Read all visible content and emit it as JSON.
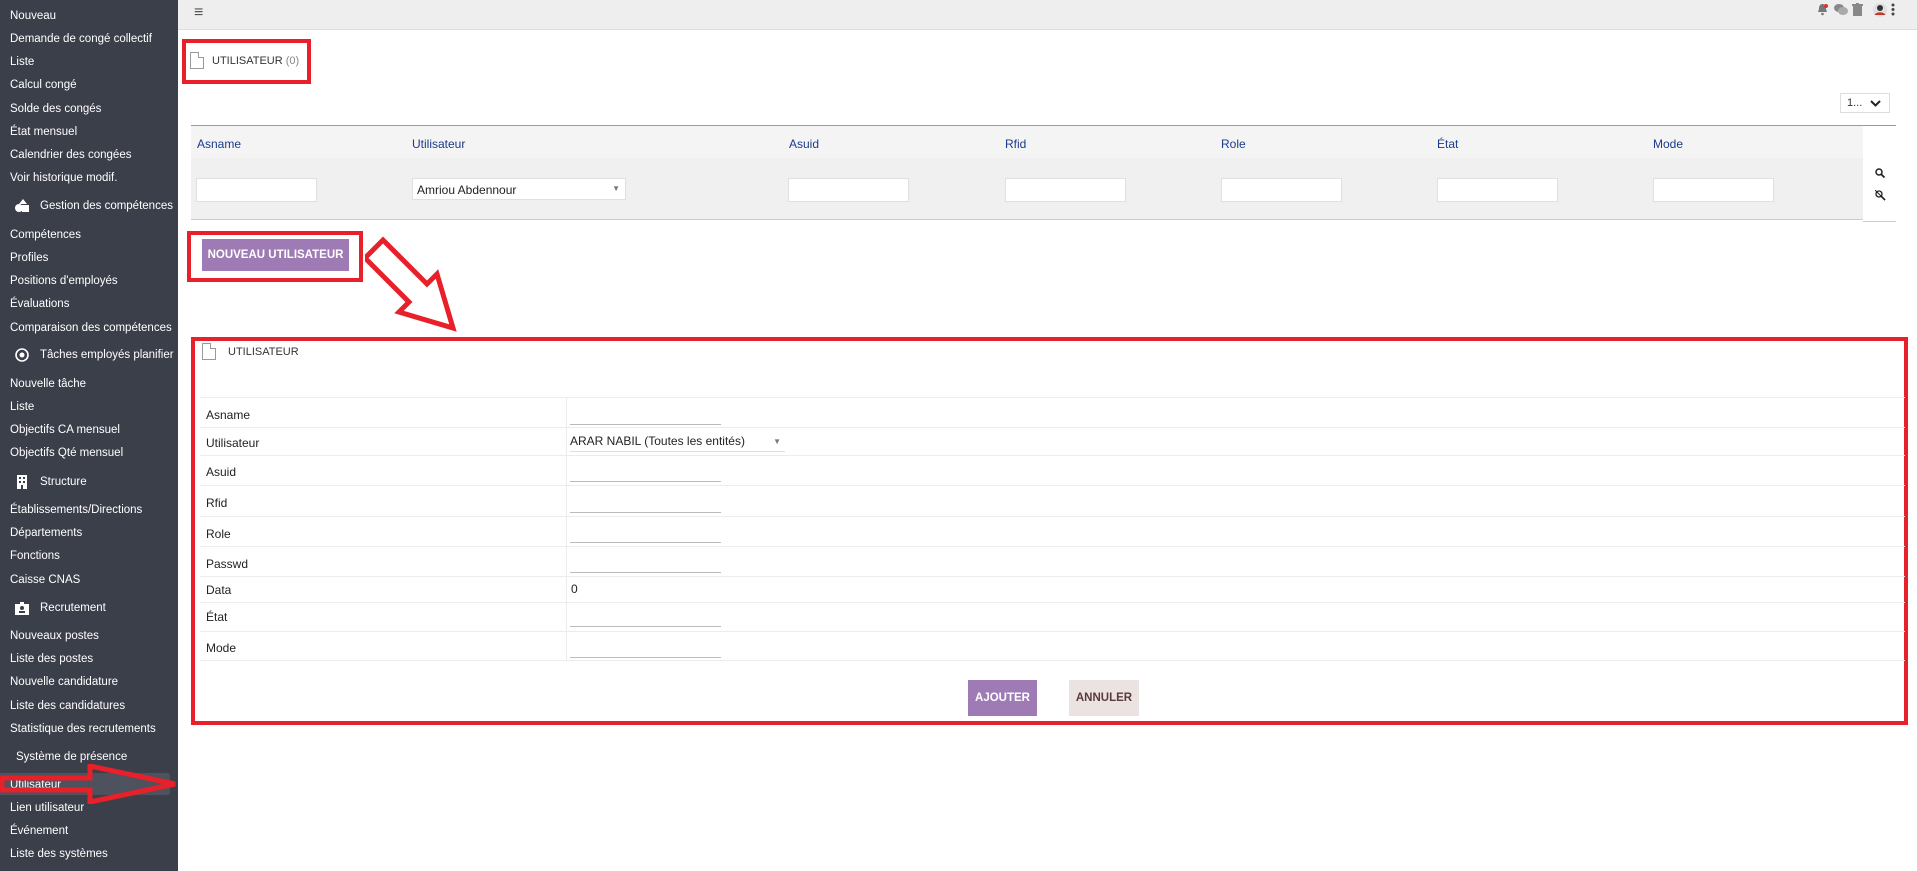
{
  "sidebar": {
    "items": [
      {
        "label": "Nouveau"
      },
      {
        "label": "Demande de congé collectif"
      },
      {
        "label": "Liste"
      },
      {
        "label": "Calcul congé"
      },
      {
        "label": "Solde des congés"
      },
      {
        "label": "État mensuel"
      },
      {
        "label": "Calendrier des congées"
      },
      {
        "label": "Voir historique modif."
      },
      {
        "label": "Gestion des compétences",
        "icon": "shapes-icon"
      },
      {
        "label": "Compétences"
      },
      {
        "label": "Profiles"
      },
      {
        "label": "Positions d'employés"
      },
      {
        "label": "Évaluations"
      },
      {
        "label": "Comparaison des compétences"
      },
      {
        "label": "Tâches employés planifier",
        "icon": "target-icon"
      },
      {
        "label": "Nouvelle tâche"
      },
      {
        "label": "Liste"
      },
      {
        "label": "Objectifs CA mensuel"
      },
      {
        "label": "Objectifs Qté mensuel"
      },
      {
        "label": "Structure",
        "icon": "building-icon"
      },
      {
        "label": "Établissements/Directions"
      },
      {
        "label": "Départements"
      },
      {
        "label": "Fonctions"
      },
      {
        "label": "Caisse CNAS"
      },
      {
        "label": "Recrutement",
        "icon": "id-badge-icon"
      },
      {
        "label": "Nouveaux postes"
      },
      {
        "label": "Liste des postes"
      },
      {
        "label": "Nouvelle candidature"
      },
      {
        "label": "Liste des candidatures"
      },
      {
        "label": "Statistique des recrutements"
      },
      {
        "label": "Système de présence"
      },
      {
        "label": "Utilisateur"
      },
      {
        "label": "Lien utilisateur"
      },
      {
        "label": "Événement"
      },
      {
        "label": "Liste des systèmes"
      }
    ]
  },
  "topbar": {
    "menu_icon": "≡",
    "icons": [
      "bell-icon",
      "chat-icon",
      "trash-icon",
      "user-avatar-icon",
      "more-vert-icon"
    ]
  },
  "list": {
    "title": "UTILISATEUR",
    "count": "(0)",
    "pager_value": "1...",
    "columns": [
      "Asname",
      "Utilisateur",
      "Asuid",
      "Rfid",
      "Role",
      "État",
      "Mode"
    ],
    "filter_user_value": "Amriou Abdennour",
    "new_button_label": "NOUVEAU UTILISATEUR"
  },
  "form": {
    "title": "UTILISATEUR",
    "fields": [
      {
        "label": "Asname",
        "value": ""
      },
      {
        "label": "Utilisateur",
        "value": "ARAR NABIL (Toutes les entités)"
      },
      {
        "label": "Asuid",
        "value": ""
      },
      {
        "label": "Rfid",
        "value": ""
      },
      {
        "label": "Role",
        "value": ""
      },
      {
        "label": "Passwd",
        "value": ""
      },
      {
        "label": "Data",
        "value": "0"
      },
      {
        "label": "État",
        "value": ""
      },
      {
        "label": "Mode",
        "value": ""
      }
    ],
    "add_label": "AJOUTER",
    "cancel_label": "ANNULER"
  },
  "colors": {
    "sidebar_bg": "#3b3f4a",
    "accent_button": "#9e7bb5",
    "highlight_red": "#e8202a",
    "header_text": "#1a3a8a"
  }
}
